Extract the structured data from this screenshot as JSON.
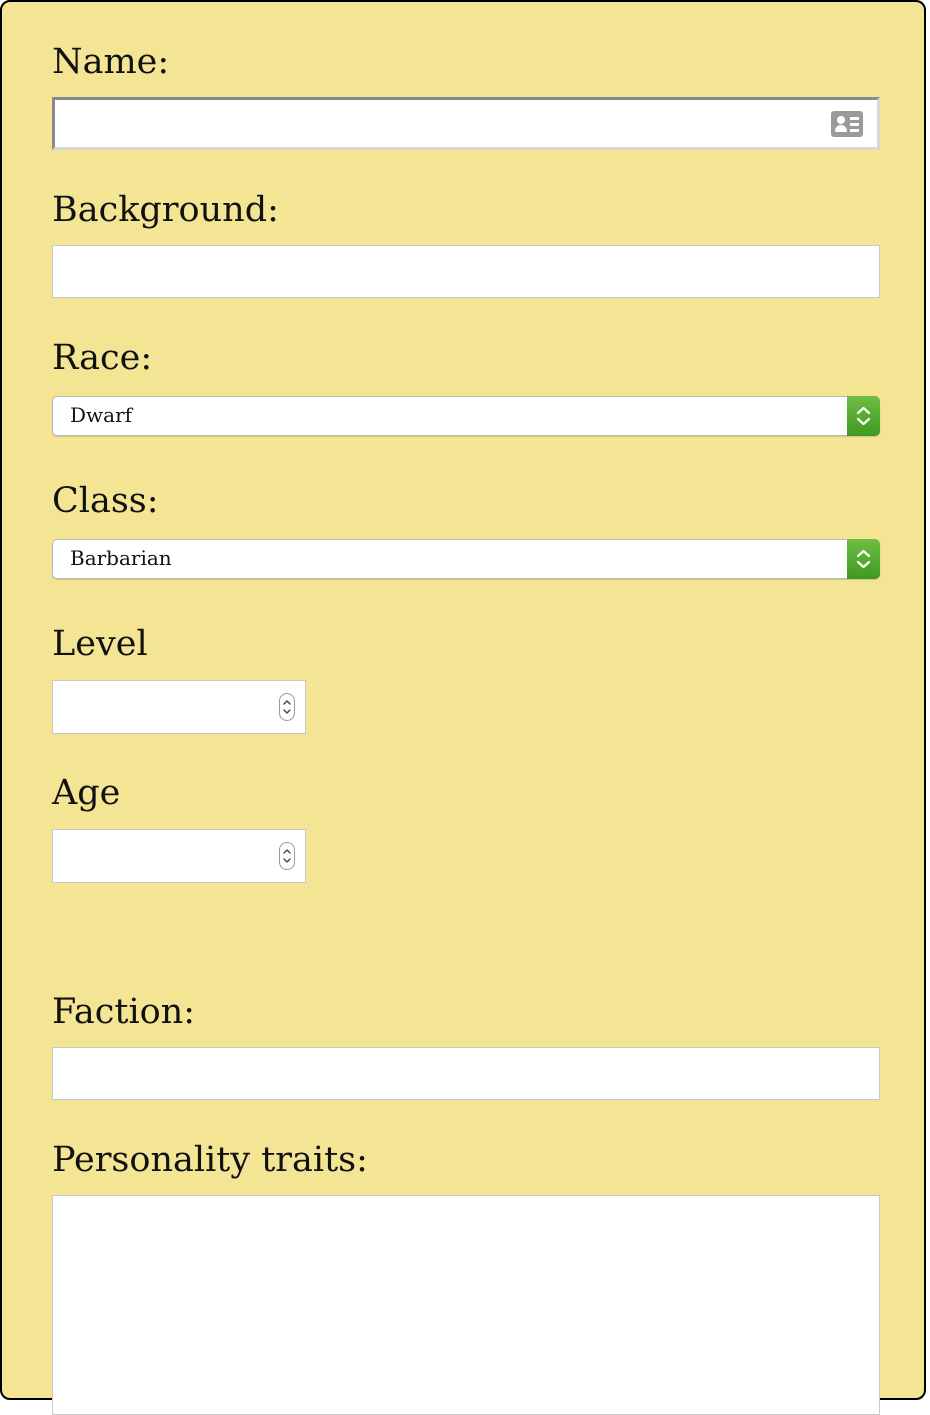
{
  "form": {
    "name": {
      "label": "Name:",
      "value": "",
      "icon": "contact-card-icon"
    },
    "background": {
      "label": "Background:",
      "value": ""
    },
    "race": {
      "label": "Race:",
      "selected": "Dwarf"
    },
    "class": {
      "label": "Class:",
      "selected": "Barbarian"
    },
    "level": {
      "label": "Level",
      "value": ""
    },
    "age": {
      "label": "Age",
      "value": ""
    },
    "faction": {
      "label": "Faction:",
      "value": ""
    },
    "personality": {
      "label": "Personality traits:",
      "value": ""
    }
  },
  "colors": {
    "panel": "#f4e594",
    "select_accent": "#4fa72b"
  }
}
